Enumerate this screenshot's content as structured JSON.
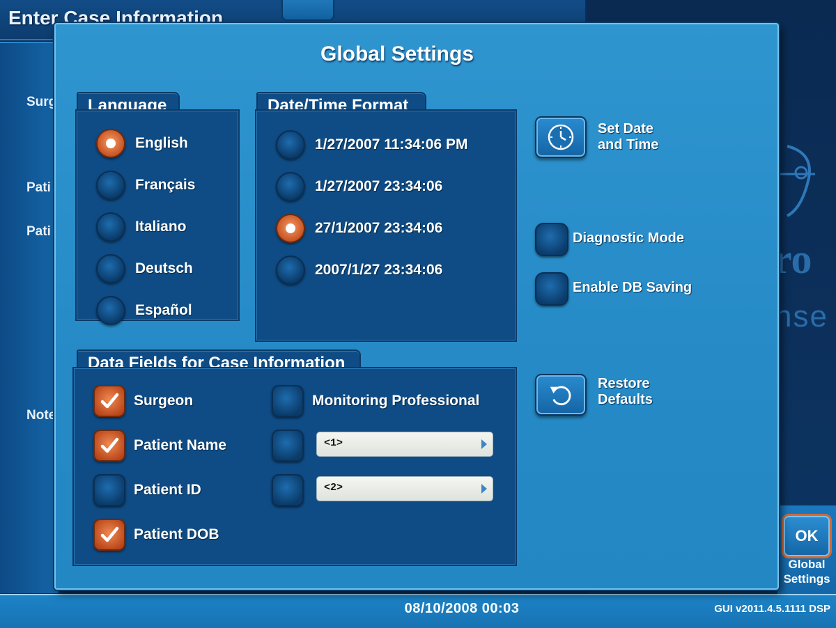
{
  "background": {
    "title": "Enter Case Information",
    "labels": [
      "Surg",
      "Pati",
      "Pati",
      "Note"
    ],
    "logo_text": "ro",
    "logo_sub": "nse"
  },
  "dialog": {
    "title": "Global Settings",
    "language": {
      "label": "Language",
      "options": [
        "English",
        "Français",
        "Italiano",
        "Deutsch",
        "Español"
      ],
      "selected": "English"
    },
    "datetime_format": {
      "label": "Date/Time Format",
      "options": [
        "1/27/2007 11:34:06 PM",
        "1/27/2007 23:34:06",
        "27/1/2007 23:34:06",
        "2007/1/27 23:34:06"
      ],
      "selected": "27/1/2007 23:34:06"
    },
    "set_date_time": {
      "line1": "Set Date",
      "line2": "and Time",
      "icon": "clock-icon"
    },
    "diagnostic_mode": {
      "label": "Diagnostic Mode",
      "checked": false
    },
    "enable_db_saving": {
      "label": "Enable DB Saving",
      "checked": false
    },
    "restore_defaults": {
      "line1": "Restore",
      "line2": "Defaults",
      "icon": "restore-icon"
    },
    "data_fields": {
      "label": "Data Fields for Case Information",
      "surgeon": {
        "label": "Surgeon",
        "checked": true
      },
      "patient_name": {
        "label": "Patient Name",
        "checked": true
      },
      "patient_id": {
        "label": "Patient ID",
        "checked": false
      },
      "patient_dob": {
        "label": "Patient DOB",
        "checked": true
      },
      "monitoring_professional": {
        "label": "Monitoring Professional",
        "checked": false
      },
      "custom1": {
        "value": "<1>",
        "checked": false
      },
      "custom2": {
        "value": "<2>",
        "checked": false
      }
    }
  },
  "ok_button": {
    "label": "OK",
    "caption_line1": "Global",
    "caption_line2": "Settings"
  },
  "footer": {
    "datetime": "08/10/2008 00:03",
    "version": "GUI v2011.4.5.1111  DSP"
  },
  "colors": {
    "selected_orange": "#d2602a",
    "panel_blue": "#0f4c85",
    "dialog_blue": "#258ac6"
  }
}
